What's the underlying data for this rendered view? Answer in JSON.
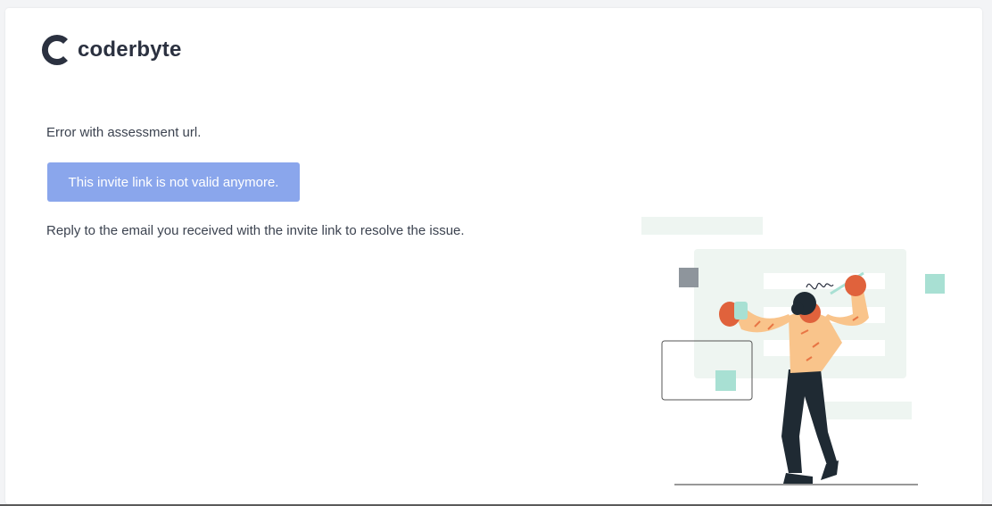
{
  "brand": {
    "name": "coderbyte",
    "logo_icon": "coderbyte-c-icon",
    "color": "#2b3140"
  },
  "message": {
    "title": "Error with assessment url.",
    "banner": "This invite link is not valid anymore.",
    "instructions": "Reply to the email you received with the invite link to resolve the issue."
  },
  "colors": {
    "banner_bg": "#8aa6ec",
    "text": "#3c4350",
    "accent_mint": "#a8e0d3",
    "illustration_bg": "#eef5f1"
  },
  "illustration": {
    "icon": "person-writing-on-board-illustration"
  }
}
